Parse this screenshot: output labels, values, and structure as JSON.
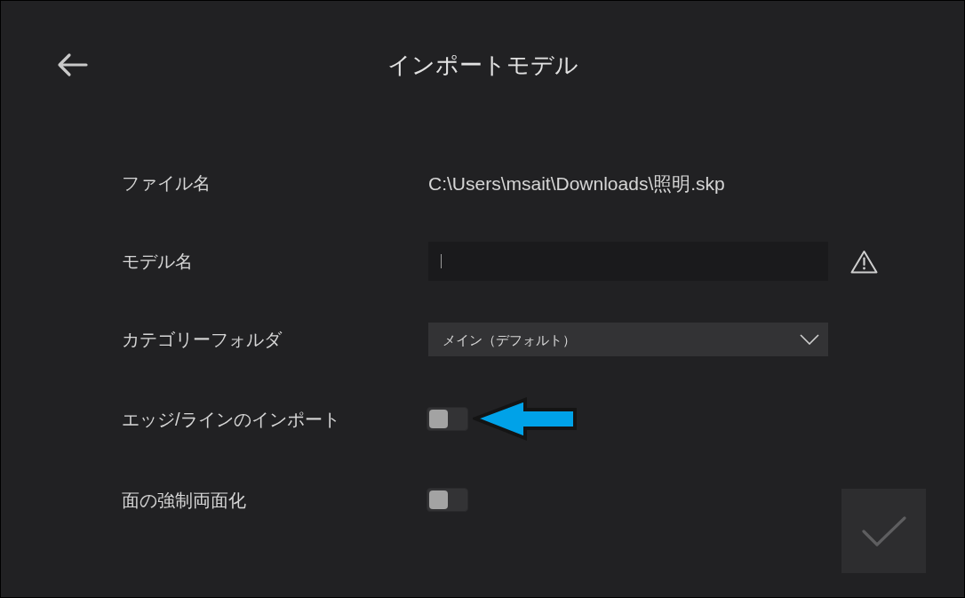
{
  "header": {
    "title": "インポートモデル"
  },
  "fields": [
    {
      "kind": "text",
      "label": "ファイル名",
      "value": "C:\\Users\\msait\\Downloads\\照明.skp"
    },
    {
      "kind": "input",
      "label": "モデル名",
      "focused": true,
      "warning": true
    },
    {
      "kind": "dropdown",
      "label": "カテゴリーフォルダ",
      "value": "メイン（デフォルト）"
    },
    {
      "kind": "toggle",
      "label": "エッジ/ラインのインポート",
      "on": false,
      "callout": true
    },
    {
      "kind": "toggle",
      "label": "面の強制両面化",
      "on": false
    }
  ],
  "confirm_button": {
    "disabled": true
  }
}
